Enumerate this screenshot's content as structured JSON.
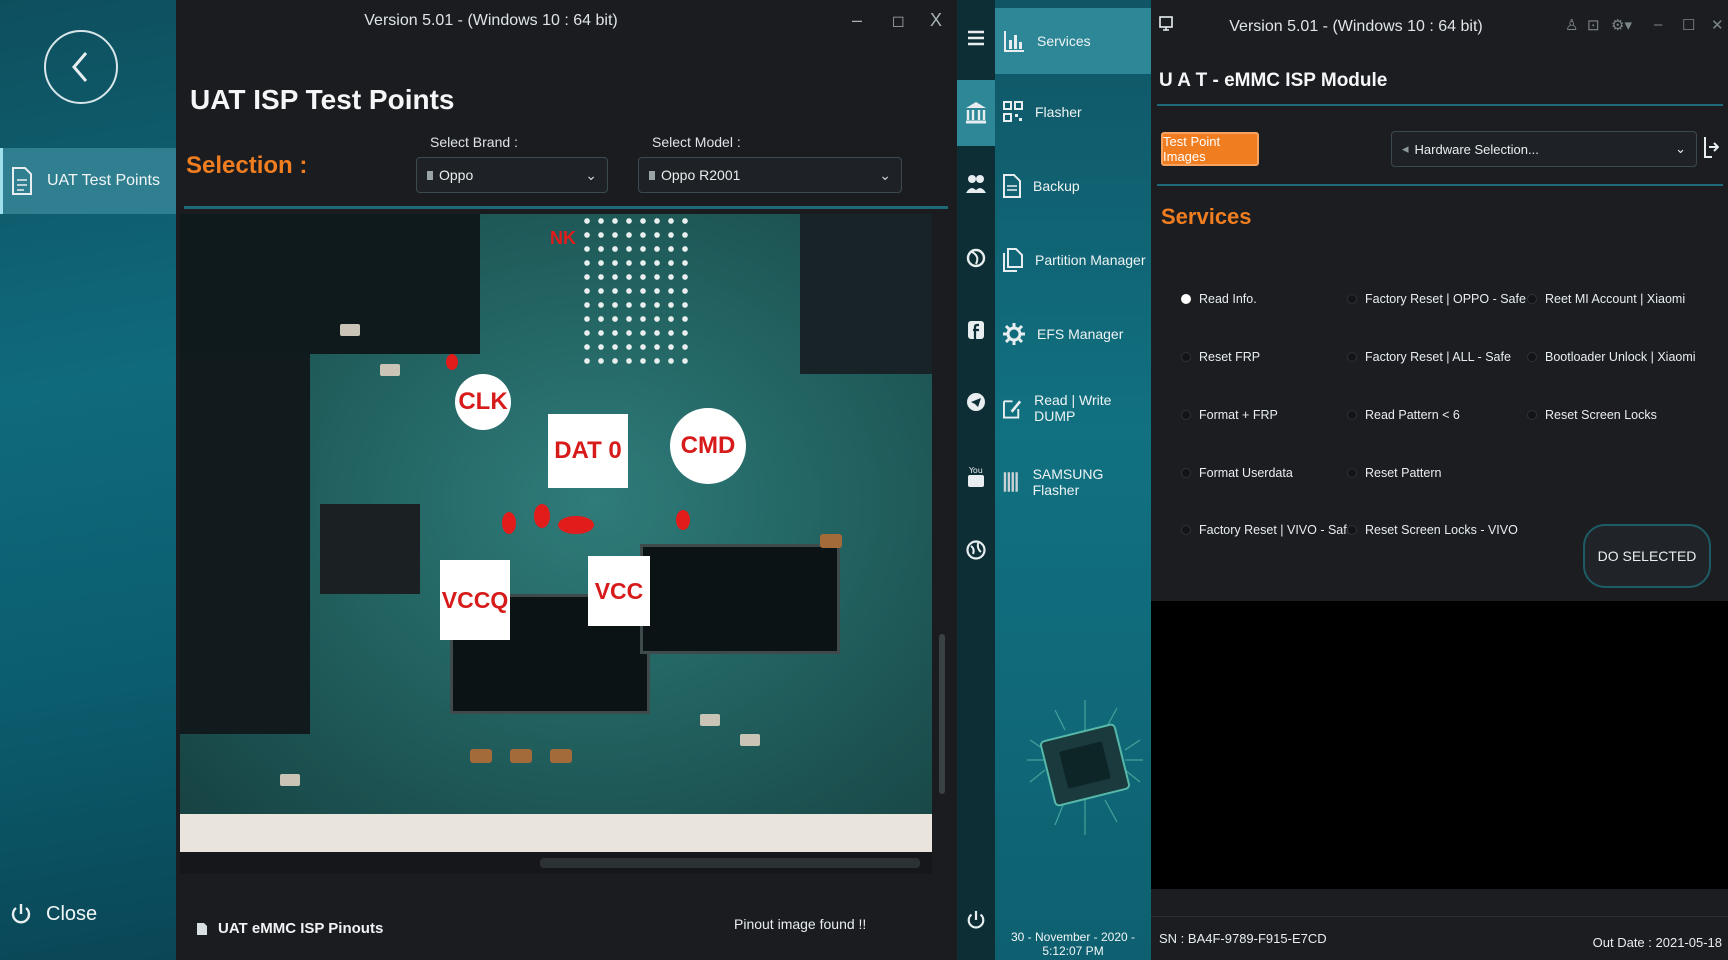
{
  "left_window": {
    "version": "Version 5.01  -  (Windows 10  : 64 bit)",
    "minimize": "–",
    "maximize": "☐",
    "close": "X",
    "sidebar": {
      "back_icon": "chevron-left-icon",
      "item_label": "UAT Test Points",
      "close_label": "Close"
    },
    "title": "UAT ISP Test Points",
    "selection_label": "Selection :",
    "brand_label": "Select Brand :",
    "brand_value": "Oppo",
    "model_label": "Select Model :",
    "model_value": "Oppo R2001",
    "image": {
      "mark": "NK",
      "labels": {
        "clk": "CLK",
        "dat0": "DAT 0",
        "cmd": "CMD",
        "vccq": "VCCQ",
        "vcc": "VCC"
      }
    },
    "status": {
      "module": "UAT eMMC ISP Pinouts",
      "message": "Pinout image found !!"
    }
  },
  "right_window": {
    "version": "Version 5.01  -  (Windows 10  : 64 bit)",
    "menu": [
      {
        "label": "Services",
        "icon": "bar-chart-icon"
      },
      {
        "label": "Flasher",
        "icon": "qr-icon"
      },
      {
        "label": "Backup",
        "icon": "document-icon"
      },
      {
        "label": "Partition Manager",
        "icon": "copy-icon"
      },
      {
        "label": "EFS Manager",
        "icon": "gear-icon"
      },
      {
        "label": "Read | Write  DUMP",
        "icon": "edit-icon"
      },
      {
        "label": "SAMSUNG Flasher",
        "icon": "stripes-icon"
      }
    ],
    "datetime": "30 - November - 2020  -  5:12:07 PM",
    "title": "U A T  - eMMC ISP Module",
    "test_point_button": "Test Point Images",
    "hardware_placeholder": "Hardware Selection...",
    "services_heading": "Services",
    "options": {
      "col1": [
        "Read Info.",
        "Reset FRP",
        "Format + FRP",
        "Format Userdata",
        "Factory Reset | VIVO - Safe"
      ],
      "col2": [
        "Factory Reset | OPPO - Safe",
        "Factory Reset | ALL - Safe",
        "Read Pattern < 6",
        "Reset Pattern",
        "Reset Screen Locks - VIVO"
      ],
      "col3": [
        "Reet MI Account | Xiaomi",
        "Bootloader Unlock | Xiaomi",
        "Reset Screen Locks"
      ]
    },
    "selected_option": "Read Info.",
    "do_button": "DO SELECTED",
    "sn": "SN : BA4F-9789-F915-E7CD",
    "out_date": "Out Date : 2021-05-18"
  },
  "colors": {
    "accent": "#f07d1f",
    "teal": "#117181",
    "panel": "#1a1c20",
    "callout_text": "#d71a1a"
  }
}
